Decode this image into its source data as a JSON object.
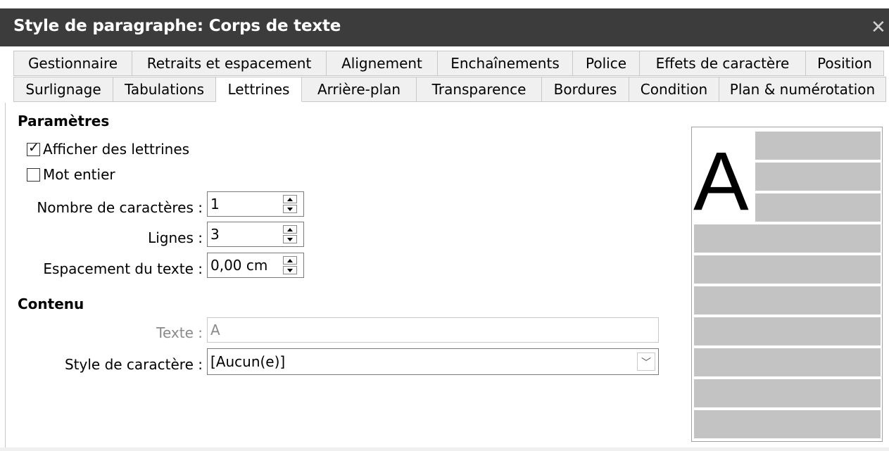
{
  "window": {
    "title": "Style de paragraphe: Corps de texte",
    "close_glyph": "✕"
  },
  "tabs": {
    "row1": [
      "Gestionnaire",
      "Retraits et espacement",
      "Alignement",
      "Enchaînements",
      "Police",
      "Effets de caractère",
      "Position"
    ],
    "row2": [
      "Surlignage",
      "Tabulations",
      "Lettrines",
      "Arrière-plan",
      "Transparence",
      "Bordures",
      "Condition",
      "Plan & numérotation"
    ],
    "active": "Lettrines"
  },
  "parametres": {
    "heading": "Paramètres",
    "show_dropcaps": {
      "label": "Afficher des lettrines",
      "checked": true
    },
    "whole_word": {
      "label": "Mot entier",
      "checked": false
    },
    "num_chars": {
      "label": "Nombre de caractères :",
      "value": "1"
    },
    "lines": {
      "label": "Lignes :",
      "value": "3"
    },
    "spacing": {
      "label": "Espacement du texte :",
      "value": "0,00 cm"
    }
  },
  "contenu": {
    "heading": "Contenu",
    "text": {
      "label": "Texte :",
      "value": "A"
    },
    "char_style": {
      "label": "Style de caractère :",
      "value": "[Aucun(e)]"
    }
  },
  "preview": {
    "letter": "A",
    "line_color": "#c3c3c3"
  }
}
